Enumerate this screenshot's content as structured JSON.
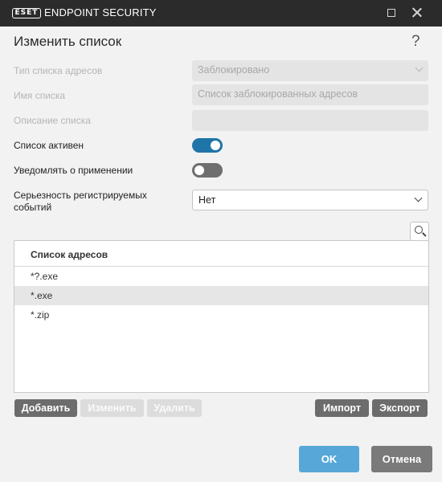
{
  "window": {
    "logo_text": "ESET",
    "product_name": "ENDPOINT SECURITY",
    "maximize_icon": "maximize-icon",
    "close_icon": "close-icon"
  },
  "dialog": {
    "title": "Изменить список",
    "help": "?"
  },
  "fields": {
    "address_list_type_label": "Тип списка адресов",
    "address_list_type_value": "Заблокировано",
    "list_name_label": "Имя списка",
    "list_name_value": "Список заблокированных адресов",
    "description_label": "Описание списка",
    "description_value": "",
    "list_active_label": "Список активен",
    "list_active": true,
    "notify_label": "Уведомлять о применении",
    "notify": false,
    "severity_label_line1": "Серьезность регистрируемых",
    "severity_label_line2": "событий",
    "severity_value": "Нет"
  },
  "address_list": {
    "header": "Список адресов",
    "rows": [
      "*?.exe",
      "*.exe",
      "*.zip"
    ],
    "selected_index": 1
  },
  "buttons": {
    "add": "Добавить",
    "edit": "Изменить",
    "delete": "Удалить",
    "import": "Импорт",
    "export": "Экспорт",
    "ok": "OK",
    "cancel": "Отмена"
  },
  "colors": {
    "titlebar": "#2b2b2b",
    "toggle_on": "#1f74a8",
    "ok_button": "#57a7d9"
  }
}
